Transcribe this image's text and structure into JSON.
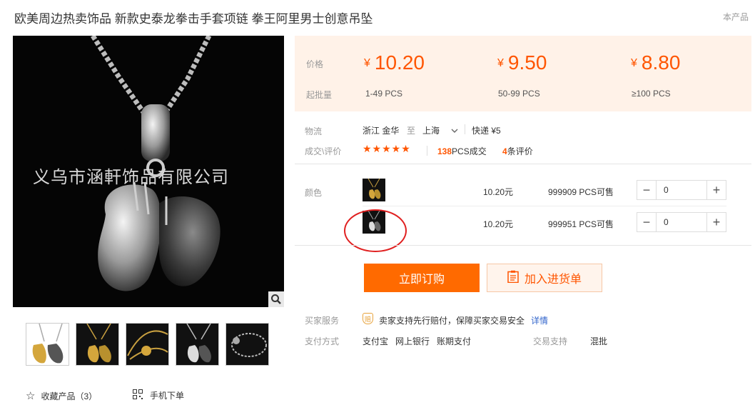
{
  "product": {
    "title": "欧美周边热卖饰品 新款史泰龙拳击手套项链 拳王阿里男士创意吊坠",
    "top_right": "本产品",
    "watermark": "义乌市涵軒饰品有限公司"
  },
  "gallery": {
    "favorite_label": "收藏产品（3）",
    "mobile_label": "手机下单"
  },
  "price": {
    "price_label": "价格",
    "moq_label": "起批量",
    "currency": "¥",
    "tiers": [
      {
        "price": "10.20",
        "qty": "1-49  PCS"
      },
      {
        "price": "9.50",
        "qty": "50-99  PCS"
      },
      {
        "price": "8.80",
        "qty": "≥100  PCS"
      }
    ]
  },
  "logistics": {
    "label": "物流",
    "from": "浙江 金华",
    "to_word": "至",
    "to": "上海",
    "shipping": "快递 ¥5"
  },
  "deals": {
    "label": "成交\\评价",
    "stars": "★★★★★",
    "sold_count": "138",
    "sold_suffix": "PCS成交",
    "review_count": "4",
    "review_suffix": "条评价"
  },
  "color": {
    "label": "颜色",
    "variants": [
      {
        "price": "10.20元",
        "stock": "999909 PCS可售",
        "qty": "0"
      },
      {
        "price": "10.20元",
        "stock": "999951 PCS可售",
        "qty": "0"
      }
    ]
  },
  "actions": {
    "buy_label": "立即订购",
    "cart_label": "加入进货单"
  },
  "service": {
    "label": "买家服务",
    "badge": "赔",
    "text": "卖家支持先行赔付，保障买家交易安全",
    "detail_link": "详情"
  },
  "payment": {
    "label": "支付方式",
    "methods": [
      "支付宝",
      "网上银行",
      "账期支付"
    ],
    "trade_label": "交易支持",
    "trade_value": "混批"
  },
  "colors": {
    "accent": "#ff5500",
    "buy_bg": "#ff6a00",
    "price_bg": "#fff2e8",
    "annotation": "#e02020"
  }
}
